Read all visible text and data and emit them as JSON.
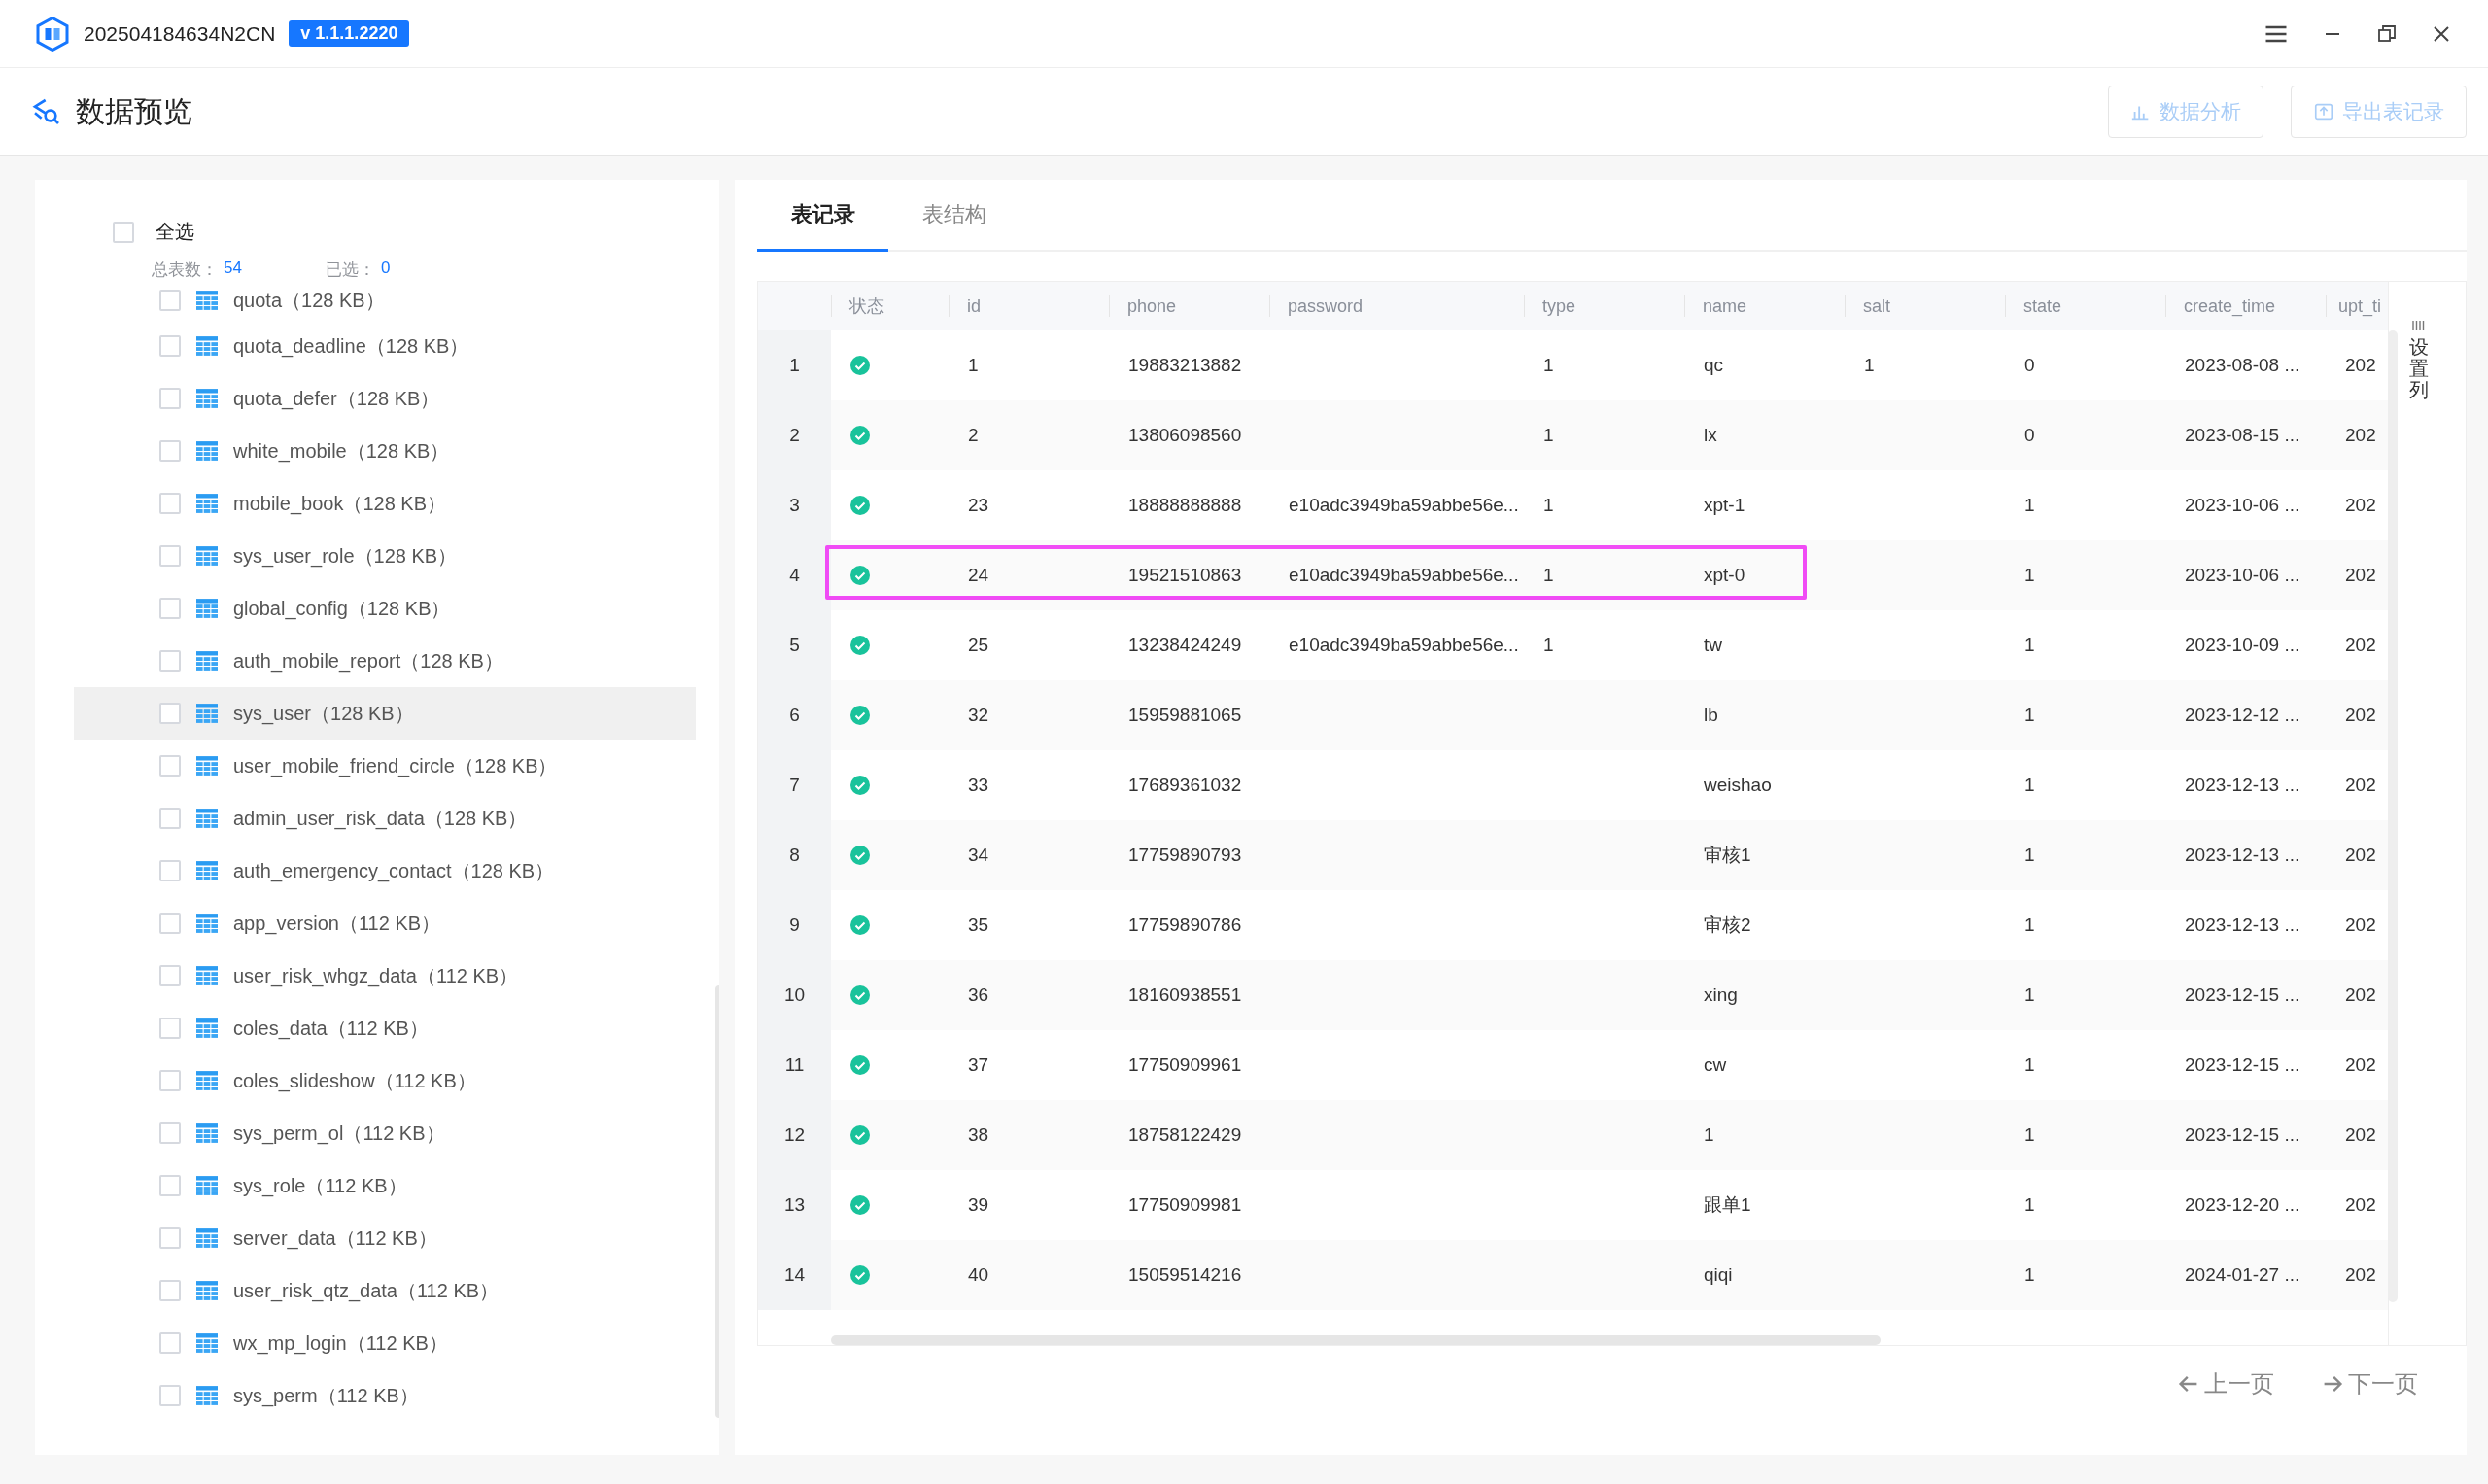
{
  "window": {
    "title": "202504184634N2CN",
    "version": "v 1.1.1.2220"
  },
  "page": {
    "title": "数据预览",
    "actions": [
      {
        "label": "数据分析",
        "kind": "analyze",
        "disabled": true
      },
      {
        "label": "导出表记录",
        "kind": "export",
        "disabled": true
      }
    ]
  },
  "sidebar": {
    "select_all": {
      "label": "全选",
      "checked": false
    },
    "total_label": "总表数：",
    "total": "54",
    "selected_label": "已选：",
    "selected_count": "0",
    "items": [
      {
        "label": "quota（128 KB）",
        "checked": false,
        "selected": false
      },
      {
        "label": "quota_deadline（128 KB）",
        "checked": false,
        "selected": false
      },
      {
        "label": "quota_defer（128 KB）",
        "checked": false,
        "selected": false
      },
      {
        "label": "white_mobile（128 KB）",
        "checked": false,
        "selected": false
      },
      {
        "label": "mobile_book（128 KB）",
        "checked": false,
        "selected": false
      },
      {
        "label": "sys_user_role（128 KB）",
        "checked": false,
        "selected": false
      },
      {
        "label": "global_config（128 KB）",
        "checked": false,
        "selected": false
      },
      {
        "label": "auth_mobile_report（128 KB）",
        "checked": false,
        "selected": false
      },
      {
        "label": "sys_user（128 KB）",
        "checked": false,
        "selected": true
      },
      {
        "label": "user_mobile_friend_circle（128 KB）",
        "checked": false,
        "selected": false
      },
      {
        "label": "admin_user_risk_data（128 KB）",
        "checked": false,
        "selected": false
      },
      {
        "label": "auth_emergency_contact（128 KB）",
        "checked": false,
        "selected": false
      },
      {
        "label": "app_version（112 KB）",
        "checked": false,
        "selected": false
      },
      {
        "label": "user_risk_whgz_data（112 KB）",
        "checked": false,
        "selected": false
      },
      {
        "label": "coles_data（112 KB）",
        "checked": false,
        "selected": false
      },
      {
        "label": "coles_slideshow（112 KB）",
        "checked": false,
        "selected": false
      },
      {
        "label": "sys_perm_ol（112 KB）",
        "checked": false,
        "selected": false
      },
      {
        "label": "sys_role（112 KB）",
        "checked": false,
        "selected": false
      },
      {
        "label": "server_data（112 KB）",
        "checked": false,
        "selected": false
      },
      {
        "label": "user_risk_qtz_data（112 KB）",
        "checked": false,
        "selected": false
      },
      {
        "label": "wx_mp_login（112 KB）",
        "checked": false,
        "selected": false
      },
      {
        "label": "sys_perm（112 KB）",
        "checked": false,
        "selected": false
      }
    ]
  },
  "tabs": [
    {
      "label": "表记录",
      "selected": true
    },
    {
      "label": "表结构",
      "selected": false
    }
  ],
  "table": {
    "columns": [
      "状态",
      "id",
      "phone",
      "password",
      "type",
      "name",
      "salt",
      "state",
      "create_time",
      "upt_ti"
    ],
    "settings_label": "设置列",
    "rows": [
      {
        "index": "1",
        "highlighted": false,
        "cells": [
          {
            "kind": "status",
            "ok": true
          },
          "1",
          "19883213882",
          "",
          "1",
          "qc",
          "1",
          "0",
          "2023-08-08 ...",
          "202"
        ]
      },
      {
        "index": "2",
        "highlighted": false,
        "cells": [
          {
            "kind": "status",
            "ok": true
          },
          "2",
          "13806098560",
          "",
          "1",
          "lx",
          "",
          "0",
          "2023-08-15 ...",
          "202"
        ]
      },
      {
        "index": "3",
        "highlighted": false,
        "cells": [
          {
            "kind": "status",
            "ok": true
          },
          "23",
          "18888888888",
          "e10adc3949ba59abbe56e...",
          "1",
          "xpt-1",
          "",
          "1",
          "2023-10-06 ...",
          "202"
        ]
      },
      {
        "index": "4",
        "highlighted": true,
        "cells": [
          {
            "kind": "status",
            "ok": true
          },
          "24",
          "19521510863",
          "e10adc3949ba59abbe56e...",
          "1",
          "xpt-0",
          "",
          "1",
          "2023-10-06 ...",
          "202"
        ]
      },
      {
        "index": "5",
        "highlighted": false,
        "cells": [
          {
            "kind": "status",
            "ok": true
          },
          "25",
          "13238424249",
          "e10adc3949ba59abbe56e...",
          "1",
          "tw",
          "",
          "1",
          "2023-10-09 ...",
          "202"
        ]
      },
      {
        "index": "6",
        "highlighted": false,
        "cells": [
          {
            "kind": "status",
            "ok": true
          },
          "32",
          "15959881065",
          "",
          "",
          "lb",
          "",
          "1",
          "2023-12-12 ...",
          "202"
        ]
      },
      {
        "index": "7",
        "highlighted": false,
        "cells": [
          {
            "kind": "status",
            "ok": true
          },
          "33",
          "17689361032",
          "",
          "",
          "weishao",
          "",
          "1",
          "2023-12-13 ...",
          "202"
        ]
      },
      {
        "index": "8",
        "highlighted": false,
        "cells": [
          {
            "kind": "status",
            "ok": true
          },
          "34",
          "17759890793",
          "",
          "",
          "审核1",
          "",
          "1",
          "2023-12-13 ...",
          "202"
        ]
      },
      {
        "index": "9",
        "highlighted": false,
        "cells": [
          {
            "kind": "status",
            "ok": true
          },
          "35",
          "17759890786",
          "",
          "",
          "审核2",
          "",
          "1",
          "2023-12-13 ...",
          "202"
        ]
      },
      {
        "index": "10",
        "highlighted": false,
        "cells": [
          {
            "kind": "status",
            "ok": true
          },
          "36",
          "18160938551",
          "",
          "",
          "xing",
          "",
          "1",
          "2023-12-15 ...",
          "202"
        ]
      },
      {
        "index": "11",
        "highlighted": false,
        "cells": [
          {
            "kind": "status",
            "ok": true
          },
          "37",
          "17750909961",
          "",
          "",
          "cw",
          "",
          "1",
          "2023-12-15 ...",
          "202"
        ]
      },
      {
        "index": "12",
        "highlighted": false,
        "cells": [
          {
            "kind": "status",
            "ok": true
          },
          "38",
          "18758122429",
          "",
          "",
          "1",
          "",
          "1",
          "2023-12-15 ...",
          "202"
        ]
      },
      {
        "index": "13",
        "highlighted": false,
        "cells": [
          {
            "kind": "status",
            "ok": true
          },
          "39",
          "17750909981",
          "",
          "",
          "跟单1",
          "",
          "1",
          "2023-12-20 ...",
          "202"
        ]
      },
      {
        "index": "14",
        "highlighted": false,
        "cells": [
          {
            "kind": "status",
            "ok": true
          },
          "40",
          "15059514216",
          "",
          "",
          "qiqi",
          "",
          "1",
          "2024-01-27 ...",
          "202"
        ]
      }
    ]
  },
  "pagination": {
    "prev": "上一页",
    "next": "下一页"
  }
}
